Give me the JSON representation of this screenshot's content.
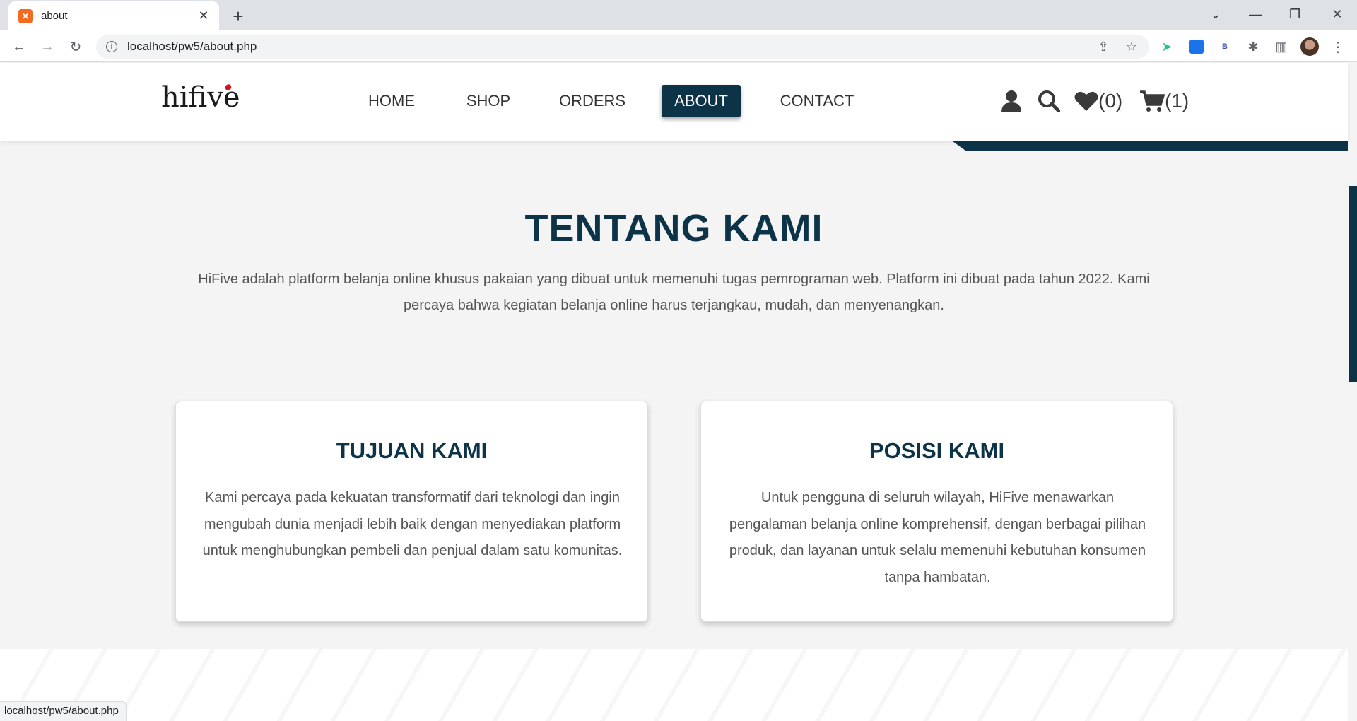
{
  "browser": {
    "tab_title": "about",
    "favicon": "xampp-icon",
    "url": "localhost/pw5/about.php",
    "status_url": "localhost/pw5/about.php"
  },
  "site": {
    "logo": "hifive",
    "nav": [
      {
        "label": "HOME",
        "active": false
      },
      {
        "label": "SHOP",
        "active": false
      },
      {
        "label": "ORDERS",
        "active": false
      },
      {
        "label": "ABOUT",
        "active": true
      },
      {
        "label": "CONTACT",
        "active": false
      }
    ],
    "wishlist_count": "(0)",
    "cart_count": "(1)",
    "brand_color": "#0d3349"
  },
  "about": {
    "title": "TENTANG KAMI",
    "description": "HiFive adalah platform belanja online khusus pakaian yang dibuat untuk memenuhi tugas pemrograman web. Platform ini dibuat pada tahun 2022. Kami percaya bahwa kegiatan belanja online harus terjangkau, mudah, dan menyenangkan."
  },
  "cards": [
    {
      "title": "TUJUAN KAMI",
      "text": "Kami percaya pada kekuatan transformatif dari teknologi dan ingin mengubah dunia menjadi lebih baik dengan menyediakan platform untuk menghubungkan pembeli dan penjual dalam satu komunitas."
    },
    {
      "title": "POSISI KAMI",
      "text": "Untuk pengguna di seluruh wilayah, HiFive menawarkan pengalaman belanja online komprehensif, dengan berbagai pilihan produk, dan layanan untuk selalu memenuhi kebutuhan konsumen tanpa hambatan."
    }
  ]
}
